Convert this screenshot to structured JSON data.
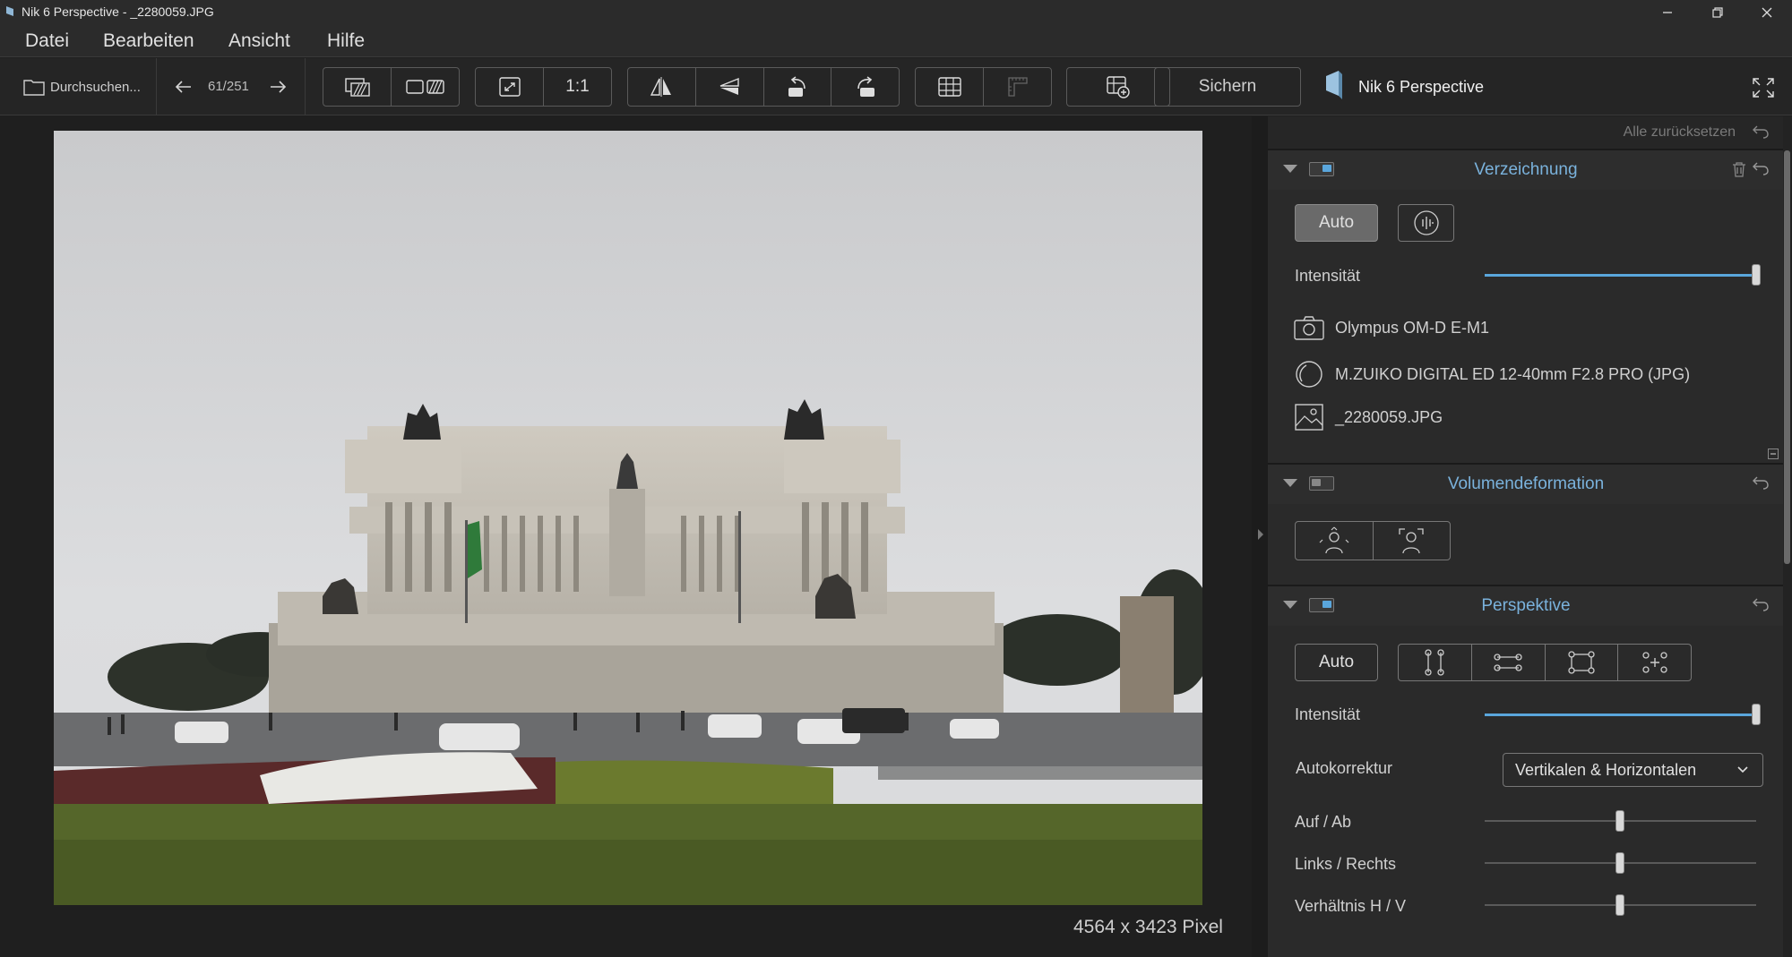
{
  "window": {
    "title": "Nik 6 Perspective - _2280059.JPG"
  },
  "menu": [
    "Datei",
    "Bearbeiten",
    "Ansicht",
    "Hilfe"
  ],
  "toolbar": {
    "browse_label": "Durchsuchen...",
    "nav_counter": "61/251",
    "zoom_1to1": "1:1",
    "save_label": "Sichern",
    "app_name": "Nik 6 Perspective"
  },
  "canvas": {
    "pixel_info": "4564 x 3423 Pixel"
  },
  "panel": {
    "reset_all": "Alle zurücksetzen",
    "verzeichnung": {
      "title": "Verzeichnung",
      "auto_label": "Auto",
      "intensity_label": "Intensität",
      "intensity_value": 1.0,
      "camera": "Olympus OM-D E-M1",
      "lens": "M.ZUIKO DIGITAL ED 12-40mm F2.8 PRO (JPG)",
      "file": "_2280059.JPG"
    },
    "volumendeformation": {
      "title": "Volumendeformation"
    },
    "perspektive": {
      "title": "Perspektive",
      "auto_label": "Auto",
      "intensity_label": "Intensität",
      "intensity_value": 1.0,
      "autocorrect_label": "Autokorrektur",
      "autocorrect_value": "Vertikalen & Horizontalen",
      "updown_label": "Auf / Ab",
      "updown_value": 0.5,
      "leftright_label": "Links / Rechts",
      "leftright_value": 0.5,
      "ratio_label": "Verhältnis H / V",
      "ratio_value": 0.5
    }
  },
  "colors": {
    "accent": "#5aa6dc",
    "title_accent": "#7ab2dc",
    "background": "#1f1f1f",
    "panel": "#2a2a2a"
  }
}
